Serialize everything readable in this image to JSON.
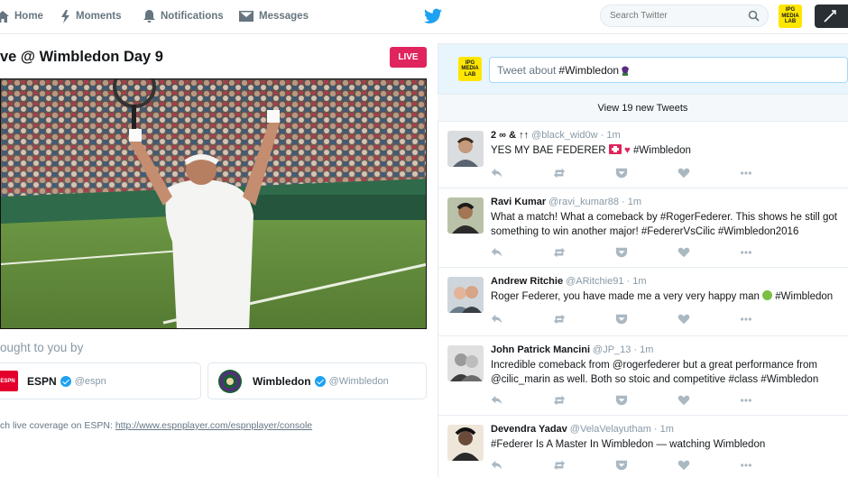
{
  "nav": {
    "home": "Home",
    "moments": "Moments",
    "notifications": "Notifications",
    "messages": "Messages",
    "search_placeholder": "Search Twitter",
    "ipg_logo": "IPG MEDIA LAB"
  },
  "event": {
    "title": "ve @ Wimbledon Day 9",
    "live_label": "LIVE",
    "brought_by": "ought to you by",
    "sponsors": [
      {
        "name": "ESPN",
        "handle": "@espn",
        "logo_text": "ESPN"
      },
      {
        "name": "Wimbledon",
        "handle": "@Wimbledon"
      }
    ],
    "coverage_text": "ch live coverage on ESPN: ",
    "coverage_link": "http://www.espnplayer.com/espnplayer/console"
  },
  "composer": {
    "prefix": "Tweet about",
    "hashtag": "#Wimbledon",
    "logo_text": "IPG MEDIA LAB"
  },
  "new_tweets": "View 19 new Tweets",
  "tweets": [
    {
      "name": "2 ∞ & ↑↑",
      "handle": "@black_wid0w",
      "time": "· 1m",
      "text_a": "YES MY BAE FEDERER ",
      "text_b": " #Wimbledon"
    },
    {
      "name": "Ravi Kumar",
      "handle": "@ravi_kumar88",
      "time": "· 1m",
      "line1": "What a match! What a comeback by #RogerFederer. This shows he still got",
      "line2": "something to win another major! #FedererVsCilic #Wimbledon2016"
    },
    {
      "name": "Andrew Ritchie",
      "handle": "@ARitchie91",
      "time": "· 1m",
      "text_a": "Roger Federer, you have made me a very very happy man ",
      "text_b": " #Wimbledon"
    },
    {
      "name": "John Patrick Mancini",
      "handle": "@JP_13",
      "time": "· 1m",
      "line1": "Incredible comeback from @rogerfederer but a great performance from",
      "line2": "@cilic_marin as well. Both so stoic and competitive #class #Wimbledon"
    },
    {
      "name": "Devendra Yadav",
      "handle": "@VelaVelayutham",
      "time": "· 1m",
      "line1": "#Federer Is A Master In Wimbledon — watching Wimbledon"
    }
  ]
}
